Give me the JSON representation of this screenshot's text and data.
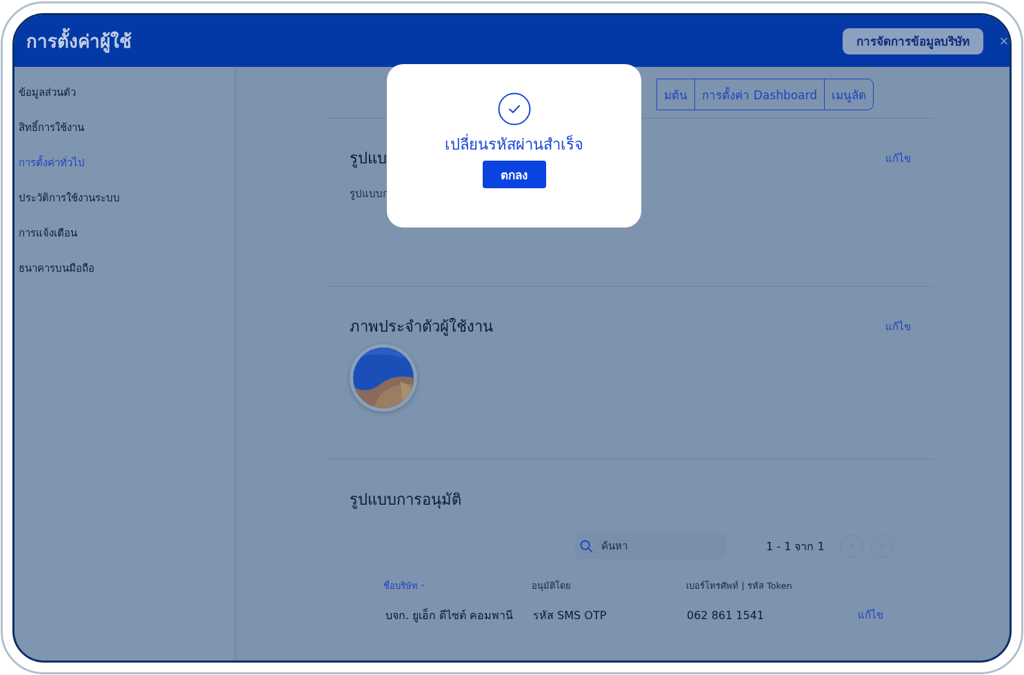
{
  "window": {
    "title": "การตั้งค่าผู้ใช้",
    "header_button": "การจัดการข้อมูลบริษัท",
    "close": "×"
  },
  "sidebar": {
    "items": [
      {
        "label": "ข้อมูลส่วนตัว",
        "selected": false
      },
      {
        "label": "สิทธิ์การใช้งาน",
        "selected": false
      },
      {
        "label": "การตั้งค่าทั่วไป",
        "selected": true
      },
      {
        "label": "ประวัติการใช้งานระบบ",
        "selected": false
      },
      {
        "label": "การแจ้งเตือน",
        "selected": false
      },
      {
        "label": "ธนาคารบนมือถือ",
        "selected": false
      }
    ]
  },
  "tabs": [
    {
      "label": "มต้น",
      "selected": false
    },
    {
      "label": "การตั้งค่า Dashboard",
      "selected": false
    },
    {
      "label": "เมนูลัด",
      "selected": false
    }
  ],
  "sections": [
    {
      "title": "รูปแบ",
      "subtitle": "รูปแบบก",
      "edit": "แก้ไข"
    },
    {
      "title": "ภาพประจำตัวผู้ใช้งาน",
      "edit": "แก้ไข"
    },
    {
      "title": "รูปแบบการอนุมัติ"
    }
  ],
  "approval": {
    "search": {
      "placeholder": "ค้นหา"
    },
    "pagination": {
      "range": "1 - 1 จาก 1",
      "prev_disabled": true,
      "next_disabled": true
    },
    "table": {
      "columns": [
        {
          "label": "ชื่อบริษัท",
          "sorted": true
        },
        {
          "label": "อนุมัติโดย",
          "sorted": false
        },
        {
          "label": "เบอร์โทรศัพท์ | รหัส Token",
          "sorted": false
        }
      ],
      "rows": [
        {
          "cells": [
            "บจก. ยูเอ็ก ดีไซต์ คอมพานี",
            "รหัส SMS OTP",
            "062 861 1541"
          ],
          "action": "แก้ไข"
        }
      ]
    }
  },
  "dialog": {
    "message": "เปลี่ยนรหัสผ่านสำเร็จ",
    "button": "ตกลง"
  }
}
